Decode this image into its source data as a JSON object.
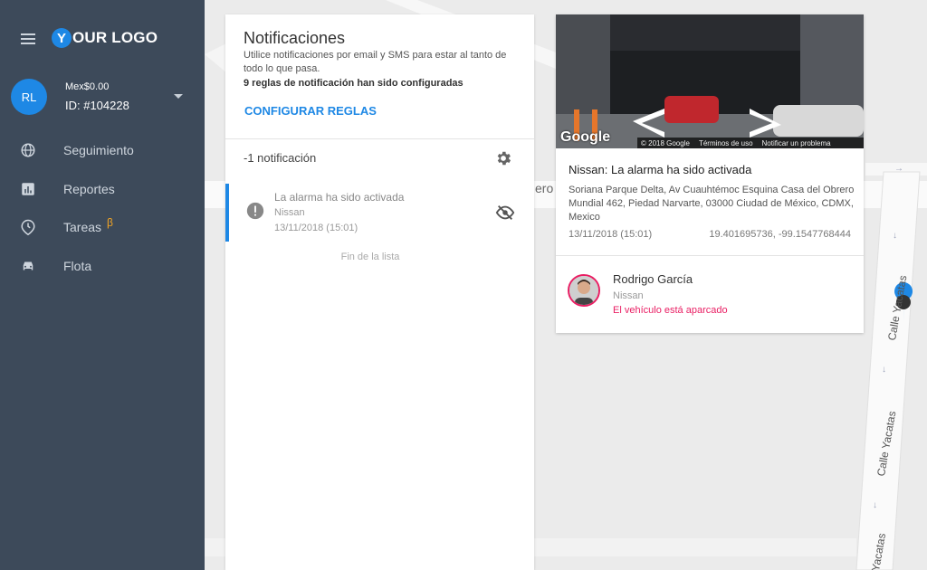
{
  "sidebar": {
    "logo_y": "Y",
    "logo_text": "OUR LOGO",
    "user_initials": "RL",
    "balance": "Mex$0.00",
    "account_id": "ID: #104228",
    "nav": [
      {
        "label": "Seguimiento",
        "icon": "globe-icon"
      },
      {
        "label": "Reportes",
        "icon": "bar-chart-icon"
      },
      {
        "label": "Tareas",
        "icon": "clock-pin-icon",
        "badge": "β"
      },
      {
        "label": "Flota",
        "icon": "car-icon"
      }
    ]
  },
  "notifications": {
    "title": "Notificaciones",
    "description": "Utilice notificaciones por email y SMS para estar al tanto de todo lo que pasa.",
    "rules_configured": "9 reglas de notificación han sido configuradas",
    "configure_button": "CONFIGURAR REGLAS",
    "count_label": "-1 notificación",
    "items": [
      {
        "title": "La alarma ha sido activada",
        "vehicle": "Nissan",
        "time": "13/11/2018 (15:01)"
      }
    ],
    "end_of_list": "Fin de la lista"
  },
  "detail": {
    "google_mark": "Google",
    "footer_copyright": "© 2018 Google",
    "footer_terms": "Términos de uso",
    "footer_report": "Notificar un problema",
    "title": "Nissan: La alarma ha sido activada",
    "address": "Soriana Parque Delta, Av Cuauhtémoc Esquina Casa del Obrero Mundial 462, Piedad Narvarte, 03000 Ciudad de México, CDMX, Mexico",
    "time": "13/11/2018 (15:01)",
    "coords": "19.401695736, -99.1547768444",
    "driver_name": "Rodrigo García",
    "vehicle": "Nissan",
    "status": "El vehículo está aparcado"
  },
  "map": {
    "street_labels": [
      "Calle Yacatas",
      "Calle Yacatas",
      "Yacatas"
    ],
    "partial_label": "ero"
  },
  "colors": {
    "sidebar_bg": "#3d4a5a",
    "accent": "#1e88e5",
    "status_pink": "#e91e63",
    "beta": "#f5a623"
  }
}
